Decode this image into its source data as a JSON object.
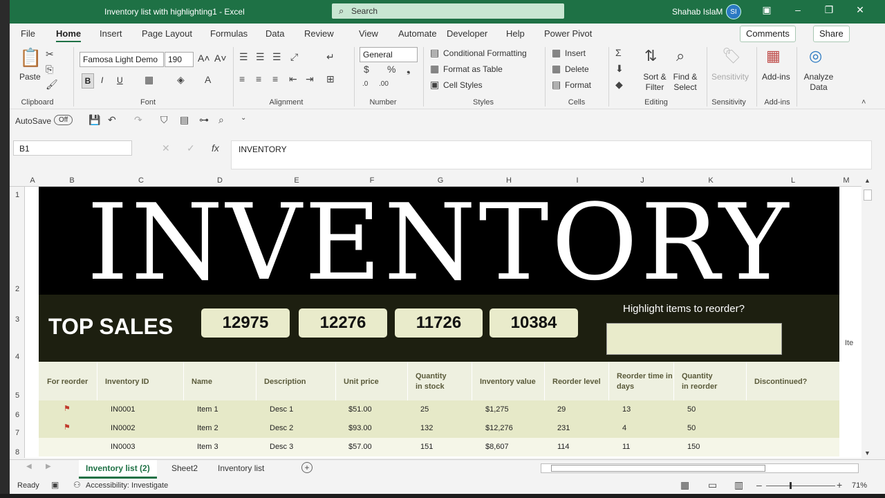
{
  "window": {
    "title": "Inventory list with highlighting1  -  Excel",
    "search_placeholder": "Search",
    "user": "Shahab IslaM",
    "initials": "SI"
  },
  "ribbon_tabs": [
    "File",
    "Home",
    "Insert",
    "Page Layout",
    "Formulas",
    "Data",
    "Review",
    "View",
    "Automate",
    "Developer",
    "Help",
    "Power Pivot"
  ],
  "comments_label": "Comments",
  "share_label": "Share",
  "ribbon": {
    "paste": "Paste",
    "clipboard": "Clipboard",
    "font_name": "Famosa Light Demo",
    "font_size": "190",
    "font": "Font",
    "bold": "B",
    "italic": "I",
    "underline": "U",
    "alignment": "Alignment",
    "number_format": "General",
    "number": "Number",
    "cond_format": "Conditional Formatting",
    "format_table": "Format as Table",
    "cell_styles": "Cell Styles",
    "styles": "Styles",
    "insert": "Insert",
    "delete": "Delete",
    "format": "Format",
    "cells": "Cells",
    "sort_filter": "Sort & Filter",
    "find_select": "Find & Select",
    "editing": "Editing",
    "sensitivity": "Sensitivity",
    "addins": "Add-ins",
    "analyze": "Analyze Data"
  },
  "qat": {
    "autosave": "AutoSave",
    "autosave_state": "Off"
  },
  "formula_bar": {
    "name_box": "B1",
    "content": "INVENTORY"
  },
  "columns": [
    "A",
    "B",
    "C",
    "D",
    "E",
    "F",
    "G",
    "H",
    "I",
    "J",
    "K",
    "L",
    "M"
  ],
  "rows": [
    "1",
    "2",
    "3",
    "4",
    "5",
    "6",
    "7",
    "8"
  ],
  "sheet": {
    "title": "INVENTORY",
    "top_sales_label": "TOP SALES",
    "top_sales": [
      "12975",
      "12276",
      "11726",
      "10384"
    ],
    "highlight_question": "Highlight items to reorder?",
    "side_text": "Ite",
    "headers": [
      "For reorder",
      "Inventory ID",
      "Name",
      "Description",
      "Unit price",
      "Quantity in stock",
      "Inventory value",
      "Reorder level",
      "Reorder time in days",
      "Quantity in reorder",
      "Discontinued?"
    ],
    "header_lines": [
      [
        "For reorder"
      ],
      [
        "Inventory ID"
      ],
      [
        "Name"
      ],
      [
        "Description"
      ],
      [
        "Unit price"
      ],
      [
        "Quantity",
        "in stock"
      ],
      [
        "Inventory value"
      ],
      [
        "Reorder level"
      ],
      [
        "Reorder time in",
        "days"
      ],
      [
        "Quantity",
        "in reorder"
      ],
      [
        "Discontinued?"
      ]
    ],
    "data": [
      {
        "flag": true,
        "id": "IN0001",
        "name": "Item 1",
        "desc": "Desc 1",
        "price": "$51.00",
        "qty": "25",
        "value": "$1,275",
        "level": "29",
        "days": "13",
        "reorder": "50"
      },
      {
        "flag": true,
        "id": "IN0002",
        "name": "Item 2",
        "desc": "Desc 2",
        "price": "$93.00",
        "qty": "132",
        "value": "$12,276",
        "level": "231",
        "days": "4",
        "reorder": "50"
      },
      {
        "flag": false,
        "id": "IN0003",
        "name": "Item 3",
        "desc": "Desc 3",
        "price": "$57.00",
        "qty": "151",
        "value": "$8,607",
        "level": "114",
        "days": "11",
        "reorder": "150"
      }
    ]
  },
  "sheet_tabs": [
    "Inventory list (2)",
    "Sheet2",
    "Inventory list"
  ],
  "status": {
    "ready": "Ready",
    "accessibility": "Accessibility: Investigate",
    "zoom": "71%"
  },
  "colors": {
    "excel_green": "#1e7145",
    "banner": "#000000",
    "sales_band": "#1d1f10",
    "box": "#e9ebcb",
    "row": "#e6e9c8",
    "row_alt": "#f5f6e8",
    "flag": "#c0392b"
  }
}
